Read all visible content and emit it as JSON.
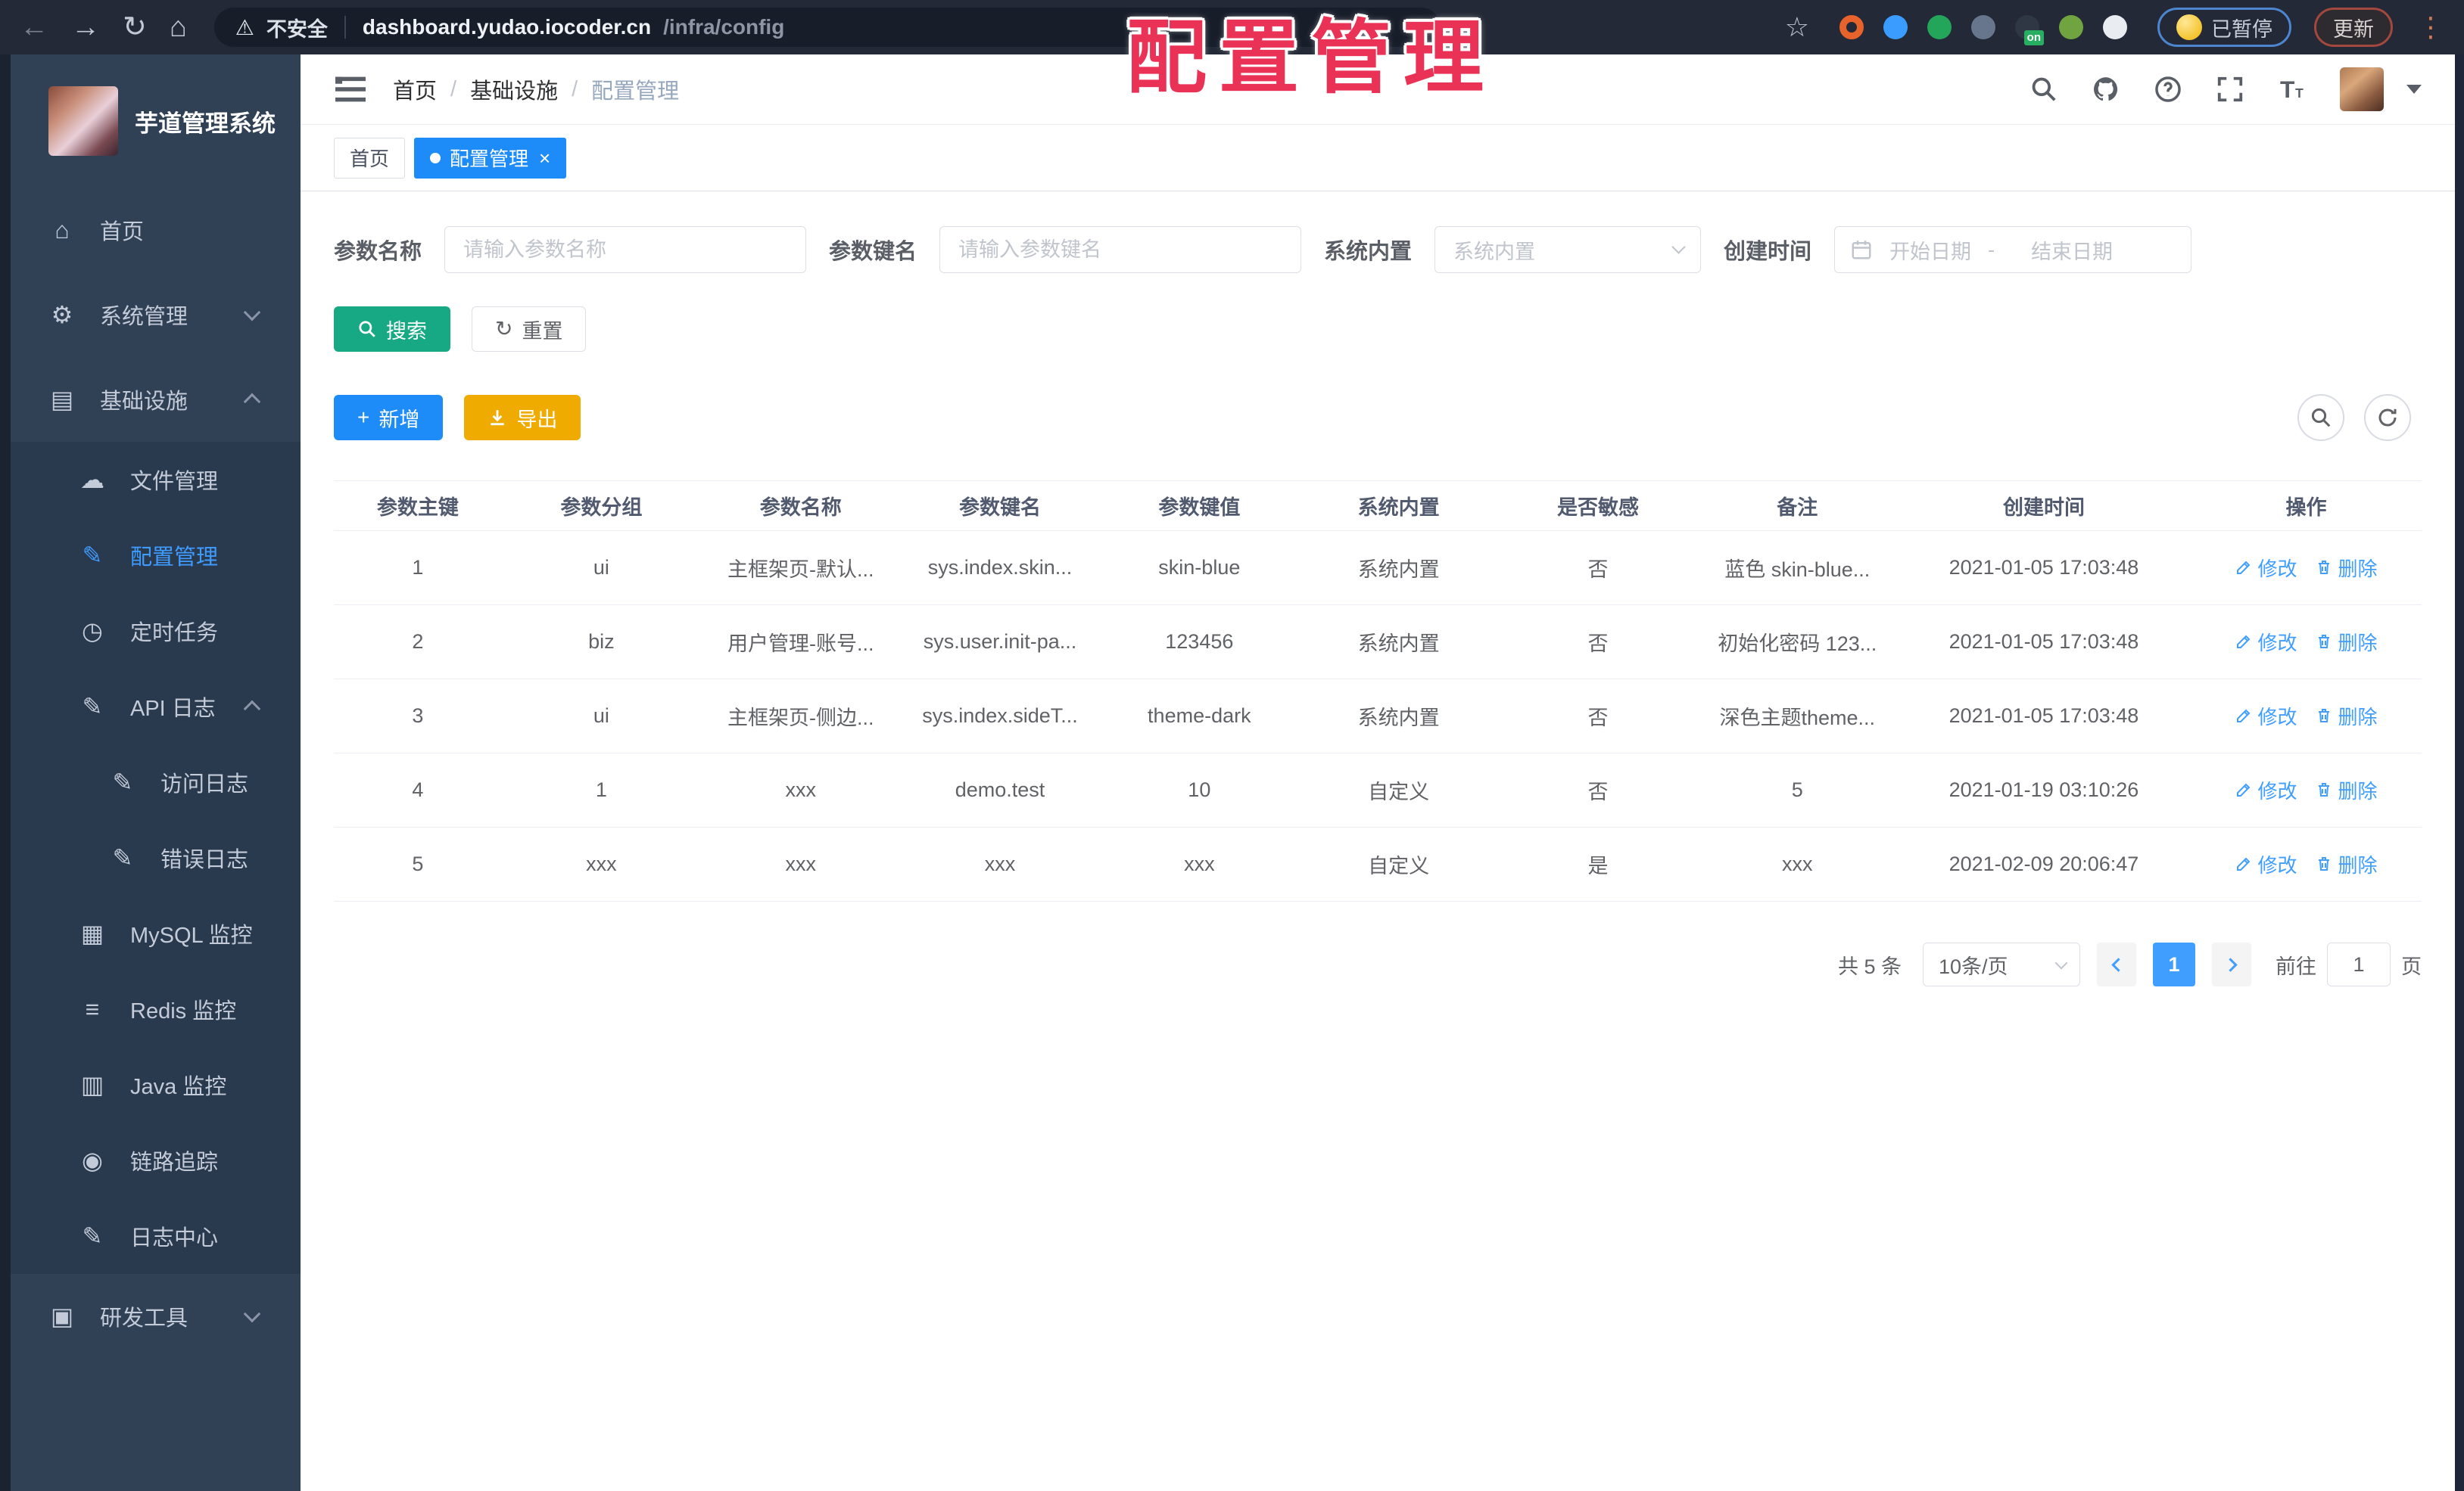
{
  "colors": {
    "primary": "#409eff",
    "tab_blue": "#1d8cf8",
    "teal": "#17a884",
    "amber": "#f0ab00",
    "overlay_red": "#ea3156",
    "sidebar_bg": "#304156",
    "chrome_bg": "#232936"
  },
  "chrome": {
    "security_label": "不安全",
    "url_host": "dashboard.yudao.iocoder.cn",
    "url_path": "/infra/config",
    "paused_badge": "已暂停",
    "update_button": "更新",
    "extensions": [
      {
        "name": "ext-orange-ring",
        "color": "#e8622c",
        "shape": "ring"
      },
      {
        "name": "ext-blue-pin",
        "color": "#3b9cff",
        "shape": "dot"
      },
      {
        "name": "ext-green-check",
        "color": "#23a55a",
        "shape": "dot"
      },
      {
        "name": "ext-slate-tool",
        "color": "#67758d",
        "shape": "dot"
      },
      {
        "name": "ext-dark-on-badge",
        "color": "#2f3744",
        "shape": "dot",
        "badge": "on"
      },
      {
        "name": "ext-green-leaf",
        "color": "#70a441",
        "shape": "dot"
      },
      {
        "name": "ext-white-puzzle",
        "color": "#e9edf2",
        "shape": "dot"
      }
    ]
  },
  "overlay": {
    "title": "配置管理"
  },
  "sidebar": {
    "title": "芋道管理系统",
    "items": [
      {
        "id": "home",
        "label": "首页",
        "icon": "home",
        "glyph": "⌂",
        "level": 1,
        "sub": false
      },
      {
        "id": "system",
        "label": "系统管理",
        "icon": "gear",
        "glyph": "⚙",
        "level": 1,
        "sub": false,
        "chevron": "down"
      },
      {
        "id": "infra",
        "label": "基础设施",
        "icon": "monitor-chart",
        "glyph": "▤",
        "level": 1,
        "sub": false,
        "chevron": "up"
      },
      {
        "id": "file",
        "label": "文件管理",
        "icon": "cloud-upload",
        "glyph": "☁",
        "level": 2,
        "sub": true
      },
      {
        "id": "config",
        "label": "配置管理",
        "icon": "edit-square",
        "glyph": "✎",
        "level": 2,
        "sub": true,
        "active": true
      },
      {
        "id": "job",
        "label": "定时任务",
        "icon": "timer",
        "glyph": "◷",
        "level": 2,
        "sub": true
      },
      {
        "id": "api-log",
        "label": "API 日志",
        "icon": "log-edit",
        "glyph": "✎",
        "level": 2,
        "sub": true,
        "chevron": "up"
      },
      {
        "id": "access-log",
        "label": "访问日志",
        "icon": "log-edit",
        "glyph": "✎",
        "level": 3,
        "sub": true
      },
      {
        "id": "error-log",
        "label": "错误日志",
        "icon": "log-edit",
        "glyph": "✎",
        "level": 3,
        "sub": true
      },
      {
        "id": "mysql",
        "label": "MySQL 监控",
        "icon": "database-monitor",
        "glyph": "▦",
        "level": 2,
        "sub": true
      },
      {
        "id": "redis",
        "label": "Redis 监控",
        "icon": "layers",
        "glyph": "≡",
        "level": 2,
        "sub": true
      },
      {
        "id": "java",
        "label": "Java 监控",
        "icon": "java-monitor",
        "glyph": "▥",
        "level": 2,
        "sub": true
      },
      {
        "id": "trace",
        "label": "链路追踪",
        "icon": "eye",
        "glyph": "◉",
        "level": 2,
        "sub": true
      },
      {
        "id": "log-center",
        "label": "日志中心",
        "icon": "log-edit",
        "glyph": "✎",
        "level": 2,
        "sub": true
      },
      {
        "id": "dev-tools",
        "label": "研发工具",
        "icon": "briefcase",
        "glyph": "▣",
        "level": 1,
        "sub": false,
        "chevron": "down"
      }
    ]
  },
  "header": {
    "breadcrumb": [
      "首页",
      "基础设施",
      "配置管理"
    ]
  },
  "tabs": {
    "home": "首页",
    "active": "配置管理"
  },
  "filters": {
    "name_label": "参数名称",
    "name_placeholder": "请输入参数名称",
    "key_label": "参数键名",
    "key_placeholder": "请输入参数键名",
    "type_label": "系统内置",
    "type_placeholder": "系统内置",
    "date_label": "创建时间",
    "date_start": "开始日期",
    "date_sep": "-",
    "date_end": "结束日期"
  },
  "actions": {
    "search": "搜索",
    "reset": "重置",
    "add": "新增",
    "export": "导出"
  },
  "table": {
    "headers": [
      "参数主键",
      "参数分组",
      "参数名称",
      "参数键名",
      "参数键值",
      "系统内置",
      "是否敏感",
      "备注",
      "创建时间",
      "操作"
    ],
    "rows": [
      [
        "1",
        "ui",
        "主框架页-默认...",
        "sys.index.skin...",
        "skin-blue",
        "系统内置",
        "否",
        "蓝色 skin-blue...",
        "2021-01-05 17:03:48"
      ],
      [
        "2",
        "biz",
        "用户管理-账号...",
        "sys.user.init-pa...",
        "123456",
        "系统内置",
        "否",
        "初始化密码 123...",
        "2021-01-05 17:03:48"
      ],
      [
        "3",
        "ui",
        "主框架页-侧边...",
        "sys.index.sideT...",
        "theme-dark",
        "系统内置",
        "否",
        "深色主题theme...",
        "2021-01-05 17:03:48"
      ],
      [
        "4",
        "1",
        "xxx",
        "demo.test",
        "10",
        "自定义",
        "否",
        "5",
        "2021-01-19 03:10:26"
      ],
      [
        "5",
        "xxx",
        "xxx",
        "xxx",
        "xxx",
        "自定义",
        "是",
        "xxx",
        "2021-02-09 20:06:47"
      ]
    ],
    "row_actions": {
      "edit": "修改",
      "delete": "删除"
    }
  },
  "pagination": {
    "total": "共 5 条",
    "page_size": "10条/页",
    "current": "1",
    "goto_label": "前往",
    "goto_value": "1",
    "goto_suffix": "页"
  }
}
